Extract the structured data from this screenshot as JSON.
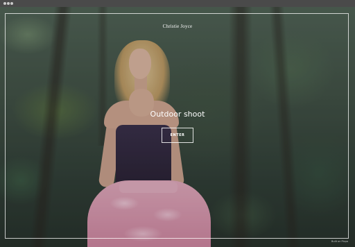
{
  "window": {
    "controls": [
      "window-dot",
      "window-dot",
      "window-dot"
    ]
  },
  "hero": {
    "image_subject": "woman in pink ruffled dress in forest"
  },
  "site": {
    "name": "Christie Joyce"
  },
  "main": {
    "headline": "Outdoor shoot",
    "enter_label": "ENTER"
  },
  "footer": {
    "built_on": "Built on Pixpa"
  },
  "colors": {
    "text": "#ffffff",
    "frame": "#ffffff",
    "titlebar": "#4a4a4a"
  }
}
